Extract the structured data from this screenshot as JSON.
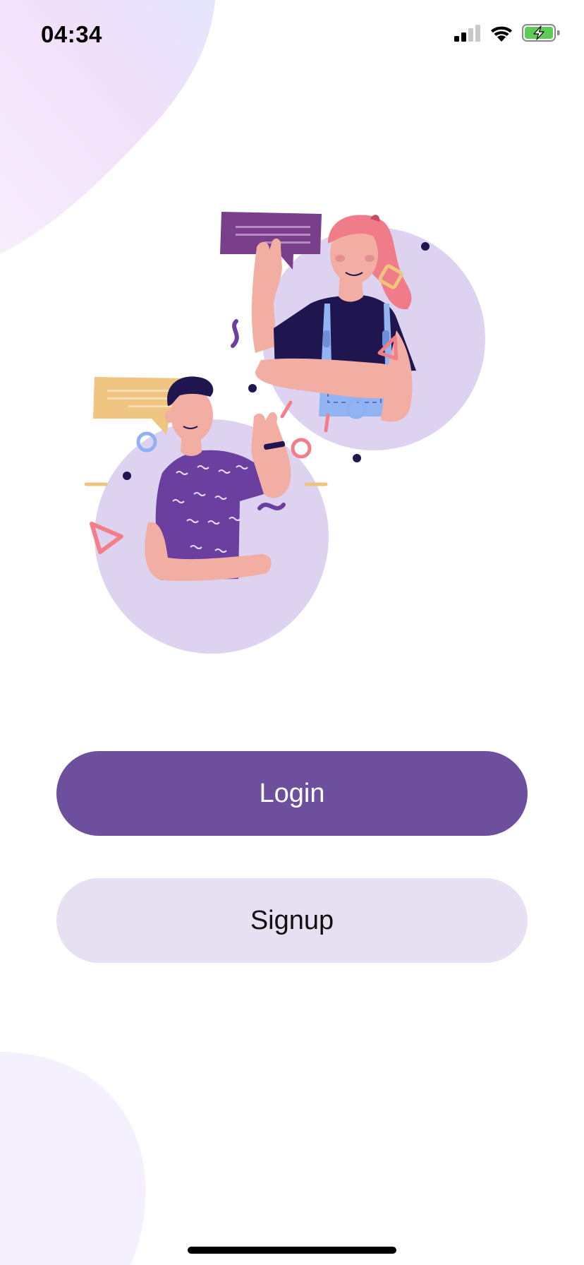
{
  "status_bar": {
    "time": "04:34",
    "icons": [
      "cellular-signal-icon",
      "wifi-icon",
      "battery-charging-icon"
    ]
  },
  "illustration": {
    "description_icon": "people-chatting-illustration"
  },
  "buttons": {
    "login_label": "Login",
    "signup_label": "Signup"
  },
  "colors": {
    "primary": "#6e4f9e",
    "secondary": "#e6e0f2",
    "accent_lavender": "#ddd3f1",
    "accent_pink": "#f27e88",
    "accent_yellow": "#eec57f",
    "accent_blue": "#8fb1f3",
    "battery_green": "#5ecb57"
  }
}
